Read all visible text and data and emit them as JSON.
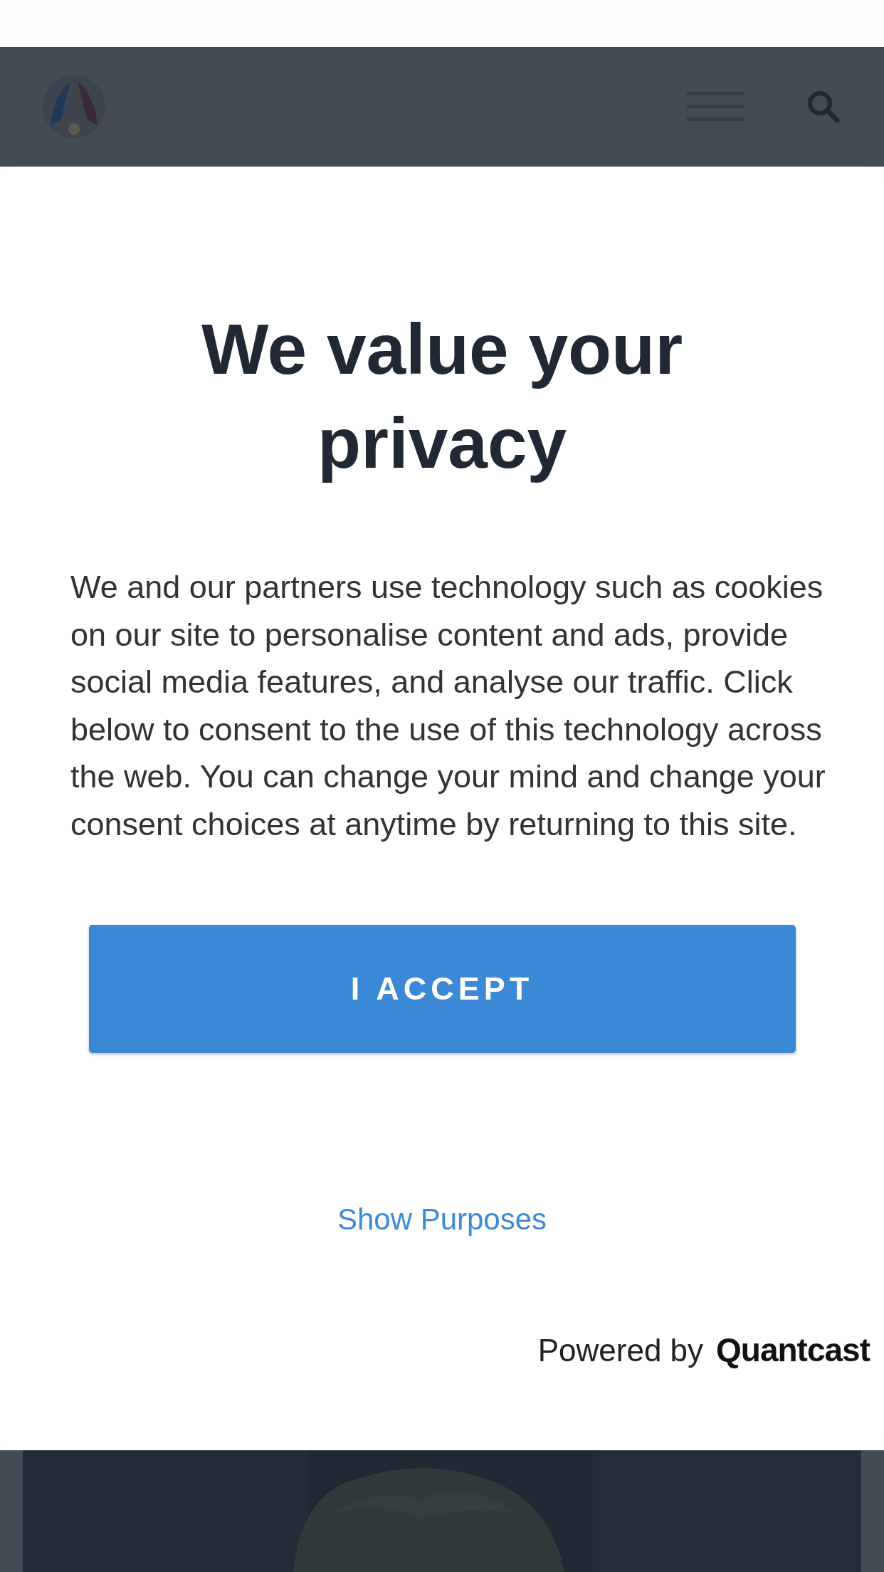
{
  "consent": {
    "title": "We value your privacy",
    "body": "We and our partners use technology such as cookies on our site to personalise content and ads, provide social media features, and analyse our traffic. Click below to consent to the use of this technology across the web. You can change your mind and change your consent choices at anytime by returning to this site.",
    "accept_button": "I ACCEPT",
    "purposes_link": "Show Purposes",
    "powered_by": "Powered by",
    "brand": "Quantcast"
  }
}
